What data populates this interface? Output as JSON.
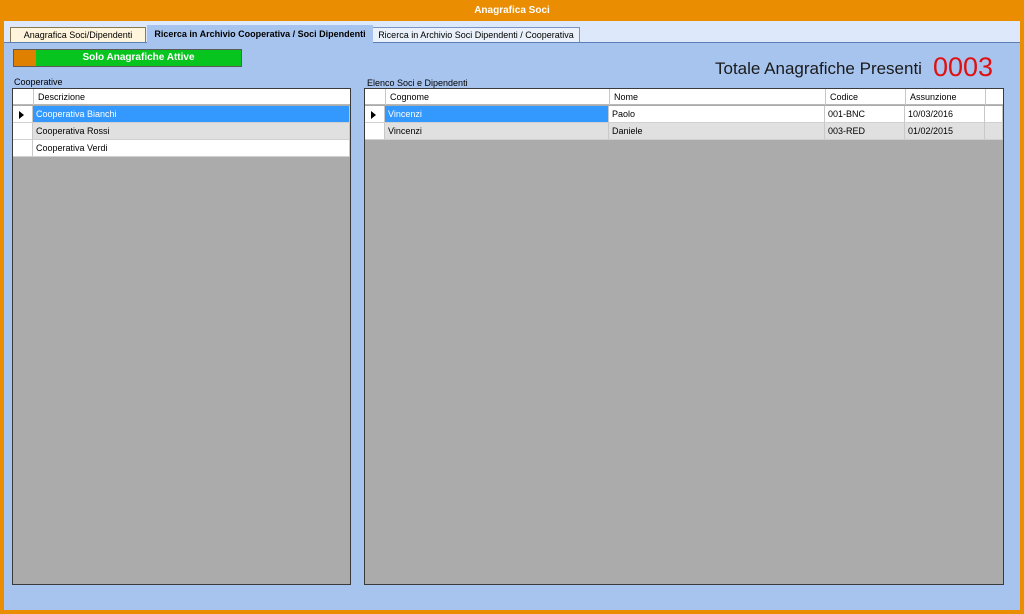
{
  "window": {
    "title": "Anagrafica Soci"
  },
  "tabs": [
    {
      "label": "Anagrafica Soci/Dipendenti"
    },
    {
      "label": "Ricerca in Archivio  Cooperativa /  Soci Dipendenti"
    },
    {
      "label": "Ricerca in Archivio Soci Dipendenti / Cooperativa"
    }
  ],
  "toggle": {
    "label": "Solo Anagrafiche Attive",
    "active": true,
    "color": "#08c41e"
  },
  "total": {
    "label": "Totale Anagrafiche Presenti",
    "value": "0003",
    "color": "#e01010"
  },
  "cooperative": {
    "label": "Cooperative",
    "columns": [
      "Descrizione"
    ],
    "rows": [
      {
        "descrizione": "Cooperativa Bianchi",
        "selected": true
      },
      {
        "descrizione": "Cooperativa Rossi",
        "selected": false
      },
      {
        "descrizione": "Cooperativa Verdi",
        "selected": false
      }
    ]
  },
  "soci": {
    "label": "Elenco Soci e Dipendenti",
    "columns": [
      "Cognome",
      "Nome",
      "Codice",
      "Assunzione"
    ],
    "rows": [
      {
        "cognome": "Vincenzi",
        "nome": "Paolo",
        "codice": "001-BNC",
        "assunzione": "10/03/2016",
        "selected": true
      },
      {
        "cognome": "Vincenzi",
        "nome": "Daniele",
        "codice": "003-RED",
        "assunzione": "01/02/2015",
        "selected": false
      }
    ]
  }
}
